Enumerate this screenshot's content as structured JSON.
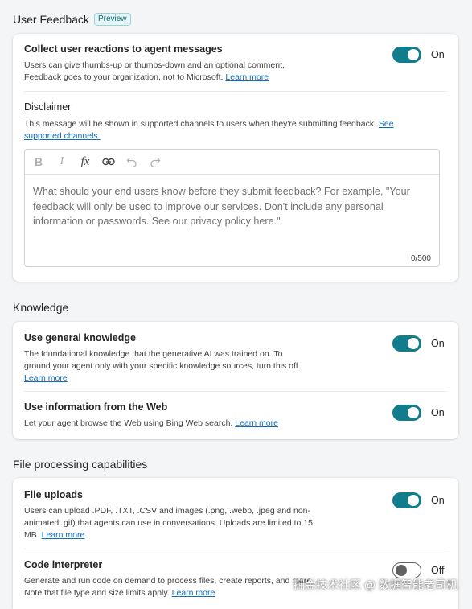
{
  "feedback": {
    "title": "User Feedback",
    "badge": "Preview",
    "collect": {
      "title": "Collect user reactions to agent messages",
      "desc_line1": "Users can give thumbs-up or thumbs-down and an optional comment.",
      "desc_line2": "Feedback goes to your organization, not to Microsoft. ",
      "link": "Learn more",
      "toggle_state": "On"
    },
    "disclaimer": {
      "title": "Disclaimer",
      "desc": "This message will be shown in supported channels to users when they're submitting feedback. ",
      "link_part1": "See",
      "link_part2": "supported channels.",
      "placeholder": "What should your end users know before they submit feedback? For example, \"Your feedback will only be used to improve our services. Don't include any personal information or passwords. See our privacy policy here.\"",
      "counter": "0/500",
      "toolbar": [
        "bold-icon",
        "italic-icon",
        "formula-icon",
        "link-icon",
        "undo-icon",
        "redo-icon"
      ]
    }
  },
  "knowledge": {
    "title": "Knowledge",
    "general": {
      "title": "Use general knowledge",
      "desc_line1": "The foundational knowledge that the generative AI was trained on. To",
      "desc_line2": "ground your agent only with your specific knowledge sources, turn this off.",
      "link": "Learn more",
      "toggle_state": "On"
    },
    "web": {
      "title": "Use information from the Web",
      "desc": "Let your agent browse the Web using Bing Web search. ",
      "link": "Learn more",
      "toggle_state": "On"
    }
  },
  "files": {
    "title": "File processing capabilities",
    "uploads": {
      "title": "File uploads",
      "desc_line1": "Users can upload .PDF, .TXT, .CSV and images (.png, .webp, .jpeg and non-",
      "desc_line2": "animated .gif) that agents can use in conversations. Uploads are limited to 15",
      "desc_line3": "MB. ",
      "link": "Learn more",
      "toggle_state": "On"
    },
    "code": {
      "title": "Code interpreter",
      "desc_line1": "Generate and run code on demand to process files, create reports, and more.",
      "desc_line2": "Note that file type and size limits apply. ",
      "link": "Learn more",
      "toggle_state": "Off"
    }
  },
  "watermark": "掘金技术社区 @ 数据智能老司机",
  "colors": {
    "accent": "#117c8b",
    "link": "#0f6cbd",
    "background": "#f4f5f7"
  }
}
